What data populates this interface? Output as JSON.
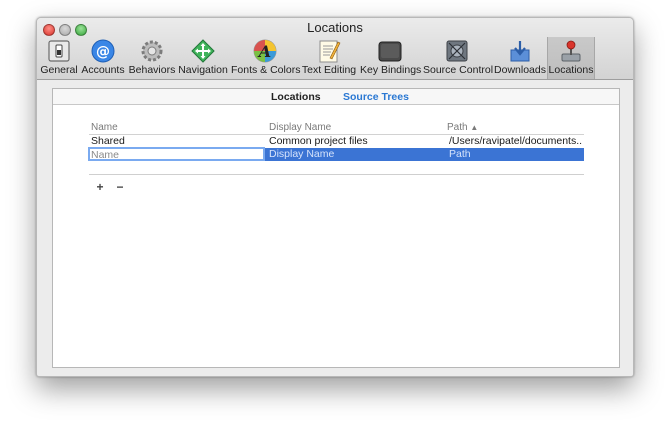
{
  "window": {
    "title": "Locations"
  },
  "toolbar": {
    "items": [
      {
        "label": "General",
        "icon": "general-switch-icon"
      },
      {
        "label": "Accounts",
        "icon": "at-sign-icon"
      },
      {
        "label": "Behaviors",
        "icon": "gears-icon"
      },
      {
        "label": "Navigation",
        "icon": "navigation-arrows-icon"
      },
      {
        "label": "Fonts & Colors",
        "icon": "fonts-colors-icon"
      },
      {
        "label": "Text Editing",
        "icon": "text-editing-icon"
      },
      {
        "label": "Key Bindings",
        "icon": "key-bindings-icon"
      },
      {
        "label": "Source Control",
        "icon": "source-control-icon"
      },
      {
        "label": "Downloads",
        "icon": "downloads-icon"
      },
      {
        "label": "Locations",
        "icon": "locations-joystick-icon"
      }
    ],
    "selected": "Locations"
  },
  "tabs": {
    "locations": "Locations",
    "source_trees": "Source Trees",
    "active": "Source Trees"
  },
  "table": {
    "columns": [
      "Name",
      "Display Name",
      "Path"
    ],
    "sort_indicator": "▲",
    "rows": [
      {
        "name": "Shared",
        "display_name": "Common project files",
        "path": "/Users/ravipatel/documents..."
      }
    ],
    "editing_row": {
      "name_placeholder": "Name",
      "display_name_placeholder": "Display Name",
      "path_placeholder": "Path"
    }
  },
  "buttons": {
    "add": "+",
    "remove": "−"
  },
  "colors": {
    "selection": "#3b74d4",
    "active_tab": "#2a78d3"
  }
}
